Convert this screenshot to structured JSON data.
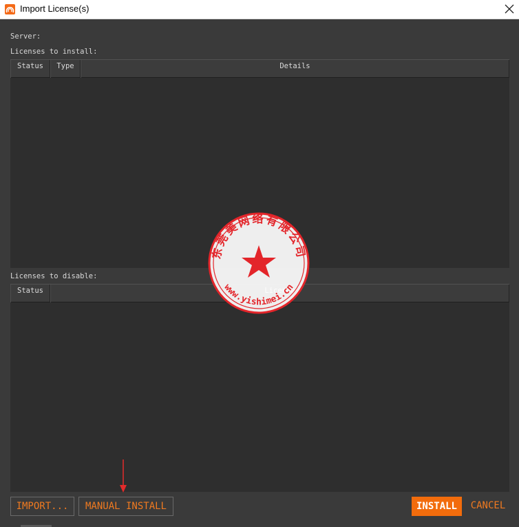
{
  "window": {
    "title": "Import License(s)",
    "icon": "houdini-app-icon",
    "close_icon": "close-icon"
  },
  "labels": {
    "server": "Server:",
    "licenses_to_install": "Licenses to install:",
    "licenses_to_disable": "Licenses to disable:"
  },
  "install_table": {
    "columns": [
      "Status",
      "Type",
      "Details"
    ],
    "rows": []
  },
  "disable_table": {
    "columns": [
      "Status",
      "License"
    ],
    "rows": []
  },
  "buttons": {
    "import": "IMPORT...",
    "manual_install": "MANUAL INSTALL",
    "install": "INSTALL",
    "cancel": "CANCEL"
  },
  "watermark": {
    "arc_text": "东莞美网络有限公司",
    "url_text": "www.yishimei.cn"
  },
  "colors": {
    "accent": "#f26c0c",
    "accent_text": "#f07a20",
    "background": "#3a3a3a",
    "seal_red": "#e3252a"
  }
}
